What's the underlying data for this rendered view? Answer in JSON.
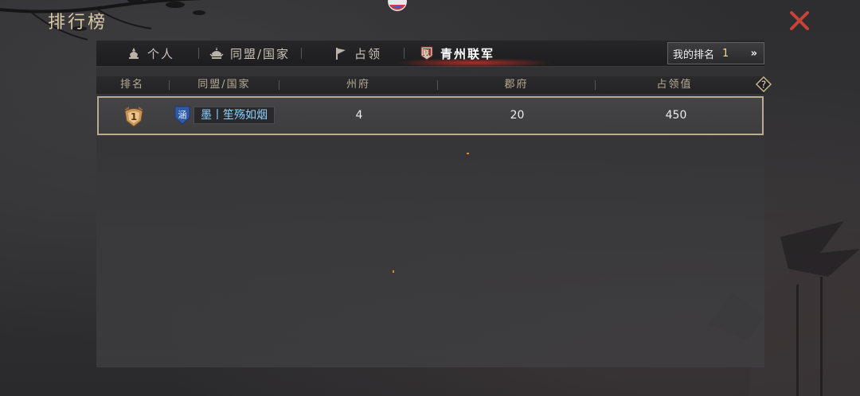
{
  "page_title": "排行榜",
  "tabs": [
    {
      "label": "个人",
      "icon": "person-helmet-icon",
      "active": false
    },
    {
      "label": "同盟/国家",
      "icon": "alliance-helmet-icon",
      "active": false
    },
    {
      "label": "占领",
      "icon": "flag-icon",
      "active": false
    },
    {
      "label": "青州联军",
      "icon": "coalition-emblem-icon",
      "active": true
    }
  ],
  "my_rank": {
    "label": "我的排名",
    "value": "1",
    "arrow": "»"
  },
  "columns": [
    "排名",
    "同盟/国家",
    "州府",
    "郡府",
    "占领值"
  ],
  "help_symbol": "?",
  "rows": [
    {
      "rank": "1",
      "shield_char": "涵",
      "alliance": "墨丨笙殇如烟",
      "zhoufu": "4",
      "junfu": "20",
      "occupy_value": "450"
    }
  ],
  "coalition_emblem_char": "联",
  "colors": {
    "accent_gold": "#d9c7a5",
    "alliance_name": "#8fd0ff",
    "close_red": "#c8423a",
    "active_glow": "#d23228"
  }
}
